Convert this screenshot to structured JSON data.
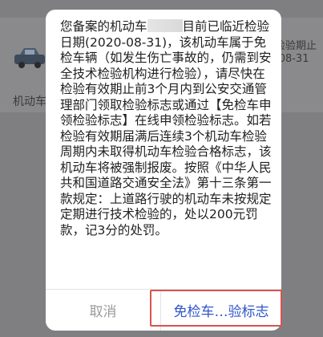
{
  "background": {
    "list_label": "机动车",
    "right_text_1": "检验期止",
    "right_text_2": "-08-31",
    "car_icon": "car-icon"
  },
  "dialog": {
    "body_part1": "您备案的机动车",
    "body_part2": "目前已临近检验日期(2020-08-31)，该机动车属于免检车辆（如发生伤亡事故的，仍需到安全技术检验机构进行检验），请尽快在检验有效期止前3个月内到公安交通管理部门领取检验标志或通过【免检车申领检验标志】在线申领检验标志。如若检验有效期届满后连续3个机动车检验周期内未取得机动车检验合格标志，该机动车将被强制报废。按照《中华人民共和国道路交通安全法》第十三条第一款规定：上道路行驶的机动车未按规定定期进行技术检验的，处以200元罚款，记3分的处罚。",
    "cancel_label": "取消",
    "primary_label": "免检车…验标志"
  },
  "colors": {
    "overlay": "#7f7f81",
    "primary": "#2f56c8",
    "cancel": "#9a9a9a",
    "highlight": "#d9534f"
  }
}
